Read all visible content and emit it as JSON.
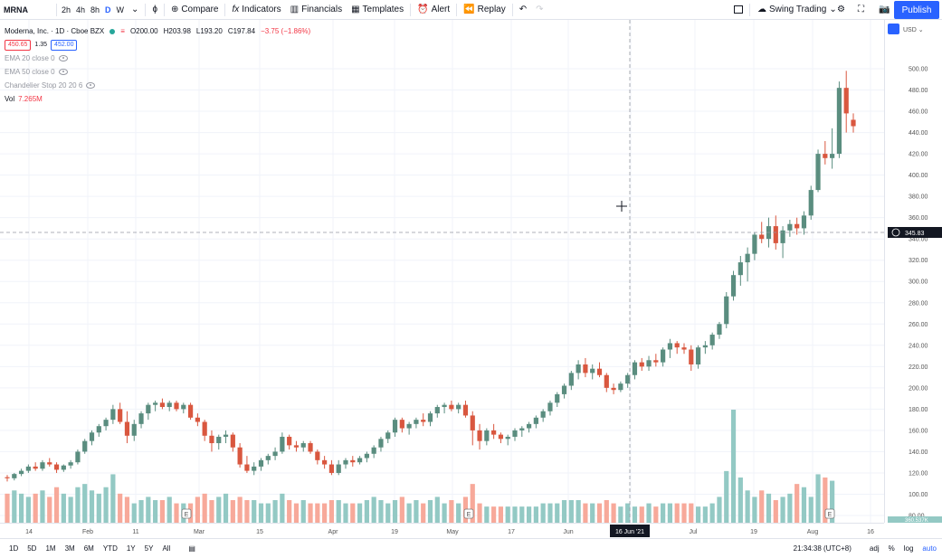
{
  "toolbar": {
    "symbol": "MRNA",
    "intervals": [
      "2h",
      "4h",
      "8h",
      "D",
      "W"
    ],
    "active_interval": "D",
    "compare": "Compare",
    "indicators": "Indicators",
    "financials": "Financials",
    "templates": "Templates",
    "alert": "Alert",
    "replay": "Replay",
    "layout": "Swing Trading",
    "publish": "Publish"
  },
  "legend": {
    "title": "Moderna, Inc. · 1D · Cboe BZX",
    "open": "O200.00",
    "high": "H203.98",
    "low": "L193.20",
    "close": "C197.84",
    "change": "−3.75 (−1.86%)",
    "bid": "450.65",
    "spread": "1.35",
    "ask": "452.00",
    "ema20": "EMA 20 close 0",
    "ema50": "EMA 50 close 0",
    "chandelier": "Chandelier Stop 20 20 6",
    "vol_label": "Vol",
    "vol_value": "7.265M"
  },
  "price_axis": {
    "currency": "USD",
    "ticks": [
      "500.00",
      "480.00",
      "460.00",
      "440.00",
      "420.00",
      "400.00",
      "380.00",
      "360.00",
      "340.00",
      "320.00",
      "300.00",
      "280.00",
      "260.00",
      "240.00",
      "220.00",
      "200.00",
      "180.00",
      "160.00",
      "140.00",
      "120.00",
      "100.00",
      "80.00"
    ],
    "crosshair_price": "345.83",
    "volume_label": "360.537K"
  },
  "time_axis": {
    "labels": [
      "14",
      "Feb",
      "11",
      "Mar",
      "15",
      "Apr",
      "19",
      "May",
      "17",
      "Jun",
      "Jul",
      "19",
      "Aug",
      "16"
    ],
    "crosshair_date": "16 Jun '21"
  },
  "bottombar": {
    "ranges": [
      "1D",
      "5D",
      "1M",
      "3M",
      "6M",
      "YTD",
      "1Y",
      "5Y",
      "All"
    ],
    "clock": "21:34:38 (UTC+8)",
    "adj": "adj",
    "percent": "%",
    "log": "log",
    "auto": "auto"
  },
  "colors": {
    "up": "#5a8d7f",
    "down": "#d9573f",
    "vol_up": "#93c9c4",
    "vol_down": "#f7a99a",
    "accent": "#2962ff"
  },
  "chart_data": {
    "type": "candlestick",
    "title": "Moderna, Inc. · 1D · Cboe BZX",
    "ylim": [
      80,
      505
    ],
    "candles": [
      [
        116,
        118,
        112,
        115
      ],
      [
        115,
        120,
        113,
        119
      ],
      [
        119,
        124,
        117,
        122
      ],
      [
        122,
        128,
        120,
        126
      ],
      [
        126,
        130,
        122,
        124
      ],
      [
        124,
        132,
        122,
        130
      ],
      [
        130,
        134,
        126,
        128
      ],
      [
        128,
        130,
        120,
        123
      ],
      [
        123,
        128,
        121,
        127
      ],
      [
        127,
        132,
        124,
        130
      ],
      [
        130,
        142,
        128,
        140
      ],
      [
        140,
        152,
        138,
        150
      ],
      [
        150,
        160,
        146,
        158
      ],
      [
        158,
        166,
        154,
        164
      ],
      [
        164,
        172,
        160,
        170
      ],
      [
        170,
        184,
        166,
        180
      ],
      [
        180,
        186,
        166,
        168
      ],
      [
        168,
        178,
        148,
        155
      ],
      [
        155,
        170,
        150,
        166
      ],
      [
        166,
        178,
        162,
        176
      ],
      [
        176,
        186,
        170,
        184
      ],
      [
        184,
        188,
        178,
        186
      ],
      [
        186,
        190,
        180,
        182
      ],
      [
        182,
        188,
        178,
        186
      ],
      [
        186,
        188,
        178,
        180
      ],
      [
        180,
        186,
        176,
        184
      ],
      [
        184,
        186,
        170,
        172
      ],
      [
        172,
        176,
        164,
        168
      ],
      [
        168,
        170,
        150,
        155
      ],
      [
        155,
        160,
        140,
        148
      ],
      [
        148,
        156,
        142,
        154
      ],
      [
        154,
        160,
        148,
        156
      ],
      [
        156,
        158,
        140,
        144
      ],
      [
        144,
        148,
        125,
        128
      ],
      [
        128,
        136,
        120,
        122
      ],
      [
        122,
        130,
        118,
        126
      ],
      [
        126,
        134,
        122,
        132
      ],
      [
        132,
        138,
        128,
        136
      ],
      [
        136,
        144,
        132,
        140
      ],
      [
        140,
        158,
        138,
        154
      ],
      [
        154,
        156,
        142,
        146
      ],
      [
        146,
        150,
        140,
        144
      ],
      [
        144,
        150,
        140,
        148
      ],
      [
        148,
        150,
        138,
        140
      ],
      [
        140,
        142,
        128,
        132
      ],
      [
        132,
        136,
        124,
        128
      ],
      [
        128,
        132,
        118,
        120
      ],
      [
        120,
        132,
        118,
        128
      ],
      [
        128,
        134,
        124,
        132
      ],
      [
        132,
        136,
        126,
        130
      ],
      [
        130,
        136,
        128,
        134
      ],
      [
        134,
        140,
        130,
        138
      ],
      [
        138,
        146,
        134,
        144
      ],
      [
        144,
        154,
        140,
        152
      ],
      [
        152,
        160,
        148,
        158
      ],
      [
        158,
        172,
        154,
        170
      ],
      [
        170,
        172,
        158,
        162
      ],
      [
        162,
        168,
        156,
        166
      ],
      [
        166,
        172,
        162,
        170
      ],
      [
        170,
        176,
        164,
        168
      ],
      [
        168,
        178,
        164,
        176
      ],
      [
        176,
        184,
        172,
        182
      ],
      [
        182,
        186,
        176,
        184
      ],
      [
        184,
        188,
        178,
        180
      ],
      [
        180,
        186,
        176,
        184
      ],
      [
        184,
        188,
        172,
        174
      ],
      [
        174,
        178,
        146,
        160
      ],
      [
        160,
        166,
        142,
        150
      ],
      [
        150,
        162,
        146,
        160
      ],
      [
        160,
        166,
        152,
        156
      ],
      [
        156,
        158,
        148,
        152
      ],
      [
        152,
        156,
        146,
        154
      ],
      [
        154,
        162,
        150,
        160
      ],
      [
        160,
        164,
        154,
        162
      ],
      [
        162,
        168,
        158,
        166
      ],
      [
        166,
        174,
        162,
        172
      ],
      [
        172,
        180,
        168,
        178
      ],
      [
        178,
        188,
        174,
        186
      ],
      [
        186,
        196,
        182,
        194
      ],
      [
        194,
        204,
        190,
        202
      ],
      [
        202,
        216,
        198,
        214
      ],
      [
        214,
        226,
        208,
        222
      ],
      [
        222,
        228,
        210,
        214
      ],
      [
        214,
        222,
        208,
        218
      ],
      [
        218,
        224,
        210,
        212
      ],
      [
        212,
        214,
        196,
        200
      ],
      [
        200,
        204,
        194,
        198
      ],
      [
        198,
        206,
        196,
        204
      ],
      [
        204,
        214,
        200,
        212
      ],
      [
        212,
        226,
        208,
        224
      ],
      [
        224,
        228,
        216,
        220
      ],
      [
        220,
        230,
        216,
        226
      ],
      [
        226,
        232,
        220,
        224
      ],
      [
        224,
        238,
        220,
        236
      ],
      [
        236,
        246,
        228,
        242
      ],
      [
        242,
        244,
        232,
        238
      ],
      [
        238,
        242,
        232,
        236
      ],
      [
        236,
        240,
        216,
        222
      ],
      [
        222,
        240,
        218,
        238
      ],
      [
        238,
        244,
        232,
        240
      ],
      [
        240,
        252,
        236,
        250
      ],
      [
        250,
        262,
        246,
        260
      ],
      [
        260,
        290,
        256,
        286
      ],
      [
        286,
        310,
        282,
        306
      ],
      [
        306,
        324,
        296,
        318
      ],
      [
        318,
        332,
        300,
        326
      ],
      [
        326,
        346,
        320,
        344
      ],
      [
        344,
        356,
        336,
        340
      ],
      [
        340,
        360,
        332,
        352
      ],
      [
        352,
        362,
        330,
        336
      ],
      [
        336,
        352,
        322,
        348
      ],
      [
        348,
        358,
        342,
        354
      ],
      [
        354,
        360,
        344,
        350
      ],
      [
        350,
        366,
        344,
        362
      ],
      [
        362,
        390,
        358,
        386
      ],
      [
        386,
        424,
        384,
        420
      ],
      [
        420,
        432,
        410,
        416
      ],
      [
        416,
        444,
        406,
        420
      ],
      [
        420,
        488,
        416,
        482
      ],
      [
        482,
        498,
        440,
        458
      ],
      [
        452,
        458,
        440,
        446
      ]
    ],
    "volume_millions": [
      9,
      10,
      9,
      8,
      9,
      10,
      8,
      11,
      9,
      8,
      11,
      12,
      10,
      9,
      11,
      15,
      9,
      8,
      6,
      7,
      8,
      7,
      7,
      8,
      6,
      6,
      6,
      8,
      9,
      7,
      8,
      9,
      7,
      8,
      7,
      7,
      6,
      6,
      7,
      9,
      7,
      6,
      7,
      6,
      6,
      6,
      7,
      7,
      6,
      6,
      6,
      7,
      8,
      7,
      6,
      7,
      8,
      6,
      7,
      6,
      7,
      8,
      6,
      7,
      6,
      8,
      12,
      6,
      5,
      5,
      5,
      5,
      5,
      5,
      5,
      5,
      6,
      6,
      6,
      7,
      7,
      7,
      6,
      6,
      6,
      7,
      6,
      5,
      6,
      5,
      5,
      6,
      5,
      6,
      6,
      6,
      6,
      6,
      5,
      5,
      6,
      8,
      16,
      35,
      14,
      10,
      8,
      10,
      9,
      7,
      8,
      9,
      12,
      11,
      8,
      15,
      14,
      13
    ]
  }
}
